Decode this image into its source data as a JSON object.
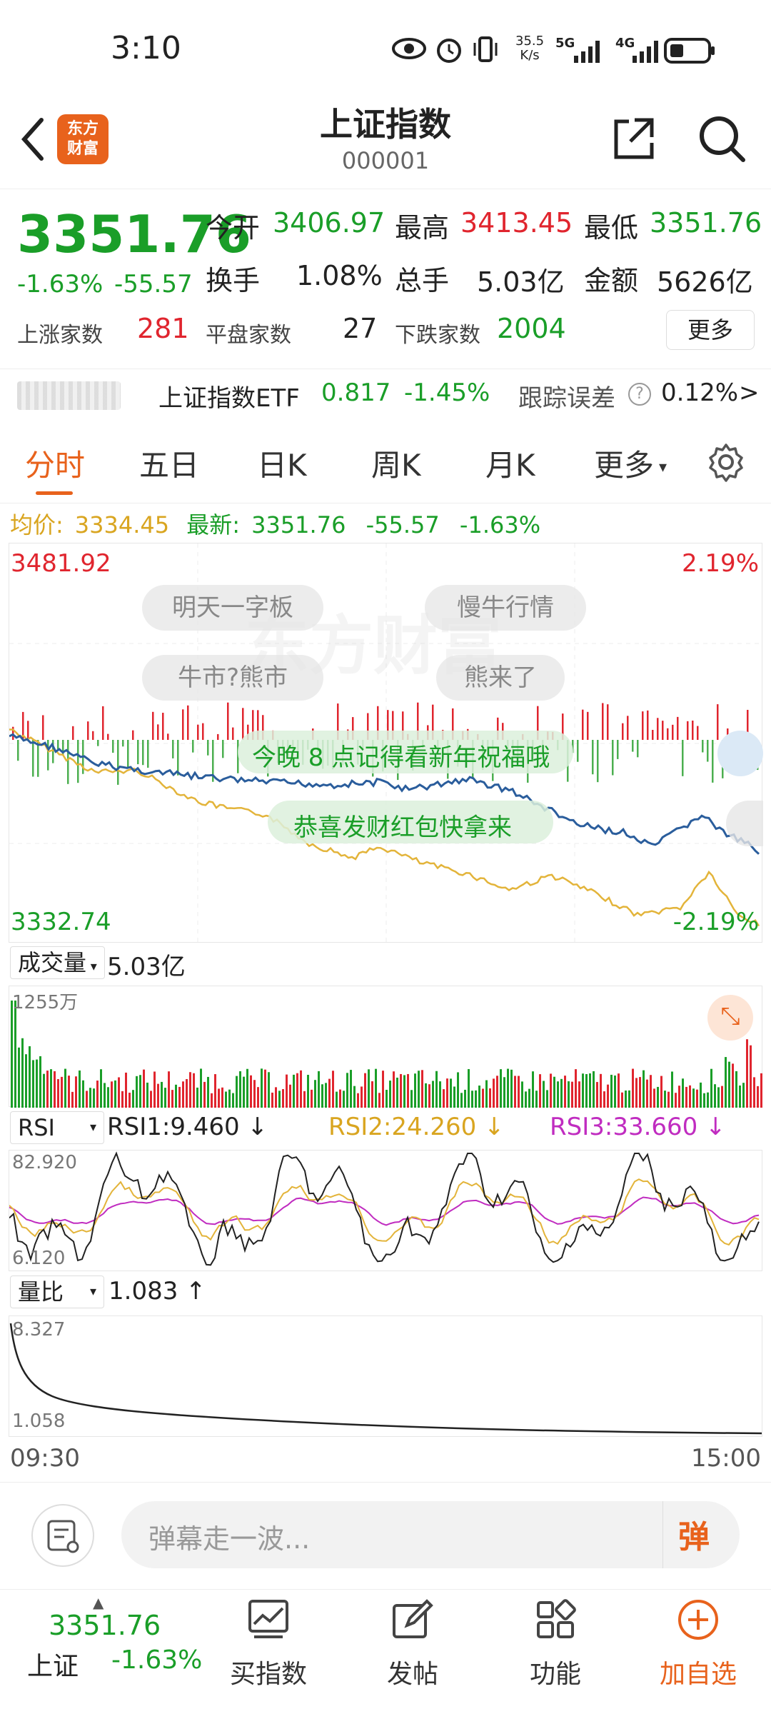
{
  "status": {
    "time": "3:10",
    "speed_top": "35.5",
    "speed_bot": "K/s",
    "net1": "5G",
    "net2": "4G"
  },
  "header": {
    "logo_line1": "东方",
    "logo_line2": "财富",
    "title": "上证指数",
    "code": "000001"
  },
  "quote": {
    "price": "3351.76",
    "pct": "-1.63%",
    "chg": "-55.57",
    "open_label": "今开",
    "open": "3406.97",
    "high_label": "最高",
    "high": "3413.45",
    "low_label": "最低",
    "low": "3351.76",
    "turnover_label": "换手",
    "turnover": "1.08%",
    "vol_label": "总手",
    "vol": "5.03亿",
    "amt_label": "金额",
    "amt": "5626亿",
    "up_label": "上涨家数",
    "up": "281",
    "flat_label": "平盘家数",
    "flat": "27",
    "down_label": "下跌家数",
    "down": "2004",
    "more": "更多"
  },
  "etf": {
    "name": "上证指数ETF",
    "price": "0.817",
    "pct": "-1.45%",
    "track_label": "跟踪误差",
    "track": "0.12%",
    "arrow": ">"
  },
  "tabs": [
    "分时",
    "五日",
    "日K",
    "周K",
    "月K",
    "更多"
  ],
  "avg_line": {
    "avg_label": "均价:",
    "avg": "3334.45",
    "latest_label": "最新:",
    "latest": "3351.76",
    "chg": "-55.57",
    "pct": "-1.63%"
  },
  "chart": {
    "ymax": "3481.92",
    "ymin": "3332.74",
    "pmax": "2.19%",
    "pmin": "-2.19%",
    "watermark": "东方财富"
  },
  "pills": [
    "明天一字板",
    "慢牛行情",
    "牛市?熊市",
    "熊来了"
  ],
  "danmaku": [
    "今晚 8 点记得看新年祝福哦",
    "恭喜发财红包快拿来"
  ],
  "volume": {
    "label": "成交量",
    "value": "5.03亿",
    "max": "1255万"
  },
  "rsi": {
    "label": "RSI",
    "rsi1": "RSI1:9.460 ↓",
    "rsi2": "RSI2:24.260 ↓",
    "rsi3": "RSI3:33.660 ↓",
    "max": "82.920",
    "min": "6.120"
  },
  "lb": {
    "label": "量比",
    "value": "1.083 ↑",
    "max": "8.327",
    "min": "1.058"
  },
  "time_axis": {
    "start": "09:30",
    "end": "15:00"
  },
  "comment": {
    "placeholder": "弹幕走一波...",
    "btn": "弹"
  },
  "bottom": {
    "price": "3351.76",
    "name": "上证",
    "pct": "-1.63%",
    "buy": "买指数",
    "post": "发帖",
    "func": "功能",
    "add": "加自选"
  },
  "colors": {
    "up": "#e0252e",
    "down": "#1a9e28",
    "accent": "#e8621c",
    "price_line": "#2a5d9c",
    "avg_line": "#e3b43a"
  }
}
